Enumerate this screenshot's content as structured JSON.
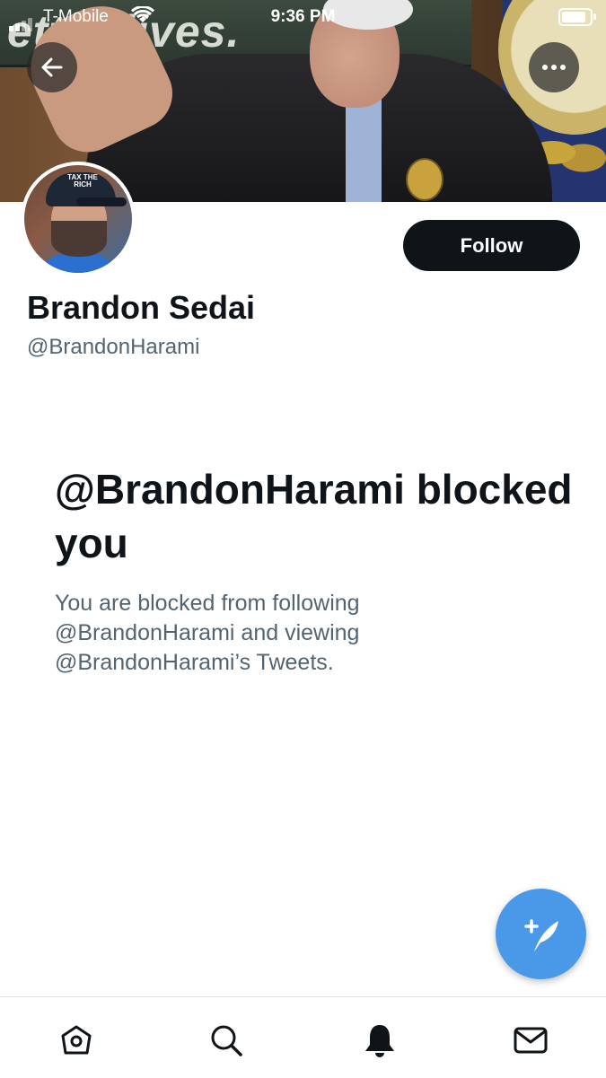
{
  "status_bar": {
    "carrier": "T-Mobile",
    "time": "9:36 PM",
    "battery_level": 1.0
  },
  "banner": {
    "sign_text": "etter lives."
  },
  "header": {
    "back_icon": "arrow-left-icon",
    "more_icon": "ellipsis-icon"
  },
  "profile": {
    "name": "Brandon Sedai",
    "handle": "@BrandonHarami",
    "follow_label": "Follow",
    "avatar_cap_text": "TAX THE RICH"
  },
  "blocked": {
    "title": "@BrandonHarami blocked you",
    "description": "You are blocked from following @BrandonHarami and viewing @BrandonHarami’s Tweets."
  },
  "fab": {
    "icon": "compose-tweet-icon"
  },
  "tabbar": {
    "items": [
      {
        "name": "home",
        "icon": "home-icon"
      },
      {
        "name": "search",
        "icon": "search-icon"
      },
      {
        "name": "notifications",
        "icon": "bell-icon"
      },
      {
        "name": "messages",
        "icon": "mail-icon"
      }
    ]
  },
  "colors": {
    "accent": "#4a99e9",
    "text_primary": "#0f1419",
    "text_secondary": "#536471"
  }
}
